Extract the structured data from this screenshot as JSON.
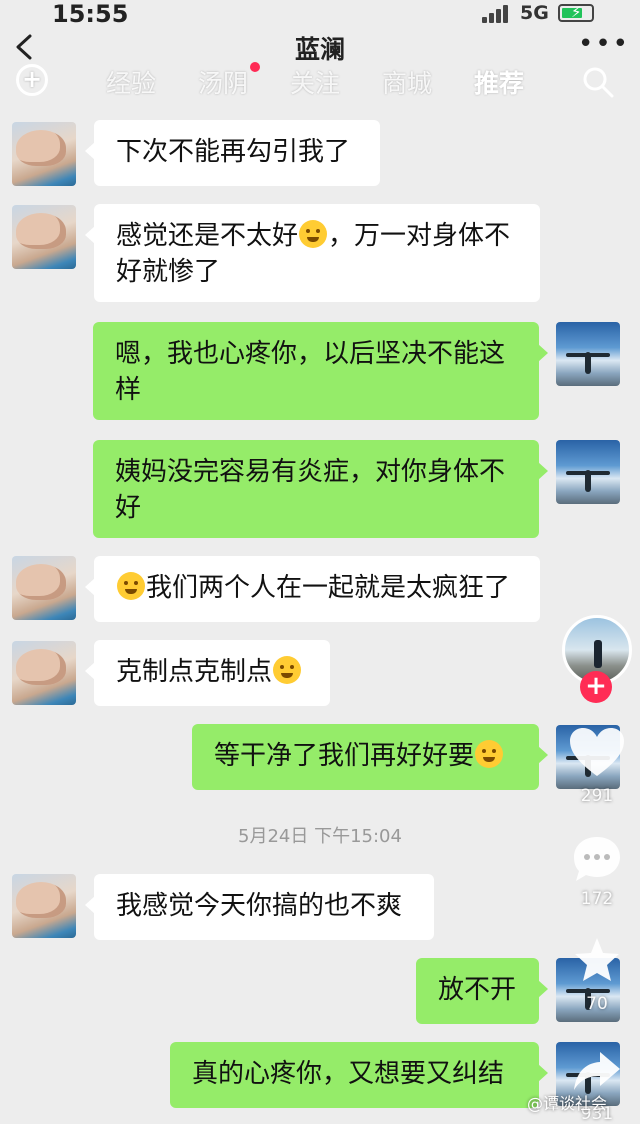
{
  "status_bar": {
    "time": "15:55",
    "network": "5G"
  },
  "header": {
    "title": "蓝澜"
  },
  "top_tabs": [
    {
      "label": "经验"
    },
    {
      "label": "汤阴"
    },
    {
      "label": "关注"
    },
    {
      "label": "商城"
    },
    {
      "label": "推荐"
    }
  ],
  "messages": [
    {
      "side": "left",
      "text": "下次不能再勾引我了"
    },
    {
      "side": "left",
      "text_a": "感觉还是不太好",
      "text_b": "，万一对身体不好就惨了"
    },
    {
      "side": "right",
      "text": "嗯，我也心疼你，以后坚决不能这样"
    },
    {
      "side": "right",
      "text": "姨妈没完容易有炎症，对你身体不好"
    },
    {
      "side": "left",
      "text": "我们两个人在一起就是太疯狂了"
    },
    {
      "side": "left",
      "text": "克制点克制点"
    },
    {
      "side": "right",
      "text": "等干净了我们再好好要"
    },
    {
      "side": "left",
      "text": "我感觉今天你搞的也不爽"
    },
    {
      "side": "right",
      "text": "放不开"
    },
    {
      "side": "right",
      "text": "真的心疼你，又想要又纠结"
    }
  ],
  "timestamp": "5月24日 下午15:04",
  "rail": {
    "likes": "291",
    "comments": "172",
    "favorites": "70",
    "shares": "931"
  },
  "watermark": "@谭谈社会",
  "colors": {
    "self_bubble": "#95ec69",
    "other_bubble": "#ffffff",
    "background": "#ededed",
    "follow_button": "#ff2c55"
  }
}
